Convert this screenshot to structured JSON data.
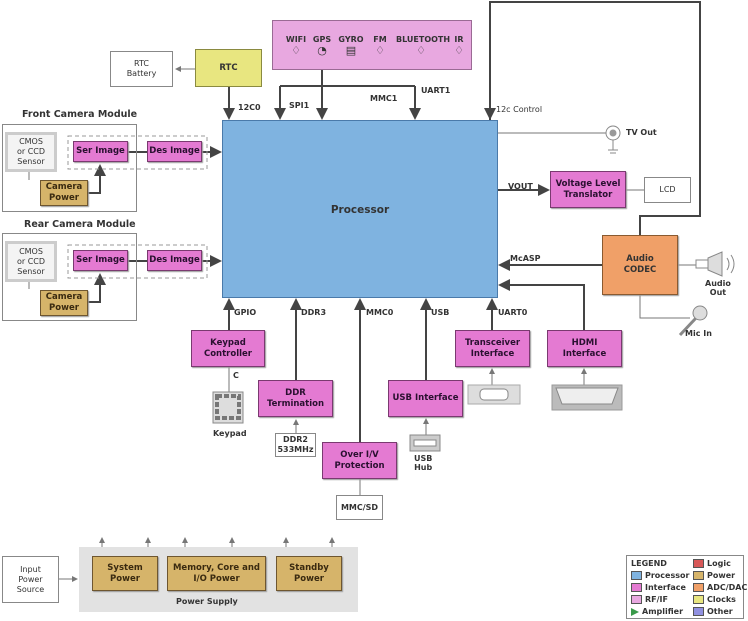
{
  "rf_block": {
    "items": [
      {
        "label": "WIFI",
        "icon": "antenna-icon"
      },
      {
        "label": "GPS",
        "icon": "gauge-icon"
      },
      {
        "label": "GYRO",
        "icon": "gyro-icon"
      },
      {
        "label": "FM",
        "icon": "antenna-icon"
      },
      {
        "label": "BLUETOOTH",
        "icon": "antenna-icon"
      },
      {
        "label": "IR",
        "icon": "antenna-icon"
      }
    ]
  },
  "rtc": {
    "label": "RTC",
    "battery": "RTC\nBattery",
    "bus": "12C0"
  },
  "processor": {
    "label": "Processor"
  },
  "buses": {
    "spi1": "SPI1",
    "mmc1": "MMC1",
    "uart1": "UART1",
    "i2c_control": "12c Control",
    "vout": "VOUT",
    "mcasp": "McASP",
    "gpio": "GPIO",
    "ddr3": "DDR3",
    "mmc0": "MMC0",
    "usb": "USB",
    "uart0": "UART0",
    "c": "C"
  },
  "front_camera": {
    "title": "Front Camera Module",
    "sensor": "CMOS\nor CCD\nSensor",
    "ser": "Ser Image",
    "des": "Des Image",
    "power": "Camera\nPower"
  },
  "rear_camera": {
    "title": "Rear Camera Module",
    "sensor": "CMOS\nor CCD\nSensor",
    "ser": "Ser Image",
    "des": "Des Image",
    "power": "Camera\nPower"
  },
  "blocks": {
    "tv_out": "TV Out",
    "vlt": "Voltage Level\nTranslator",
    "lcd": "LCD",
    "codec": "Audio\nCODEC",
    "audio_out": "Audio\nOut",
    "mic_in": "Mic In",
    "keypad_ctrl": "Keypad\nController",
    "keypad": "Keypad",
    "ddr_term": "DDR\nTermination",
    "ddr2": "DDR2\n533MHz",
    "over_iv": "Over I/V\nProtection",
    "mmc_sd": "MMC/SD",
    "usb_if": "USB Interface",
    "usb_hub": "USB\nHub",
    "transceiver": "Transceiver\nInterface",
    "hdmi": "HDMI\nInterface"
  },
  "power": {
    "input": "Input\nPower\nSource",
    "system": "System\nPower",
    "memory": "Memory, Core and\nI/O Power",
    "standby": "Standby\nPower",
    "supply": "Power Supply"
  },
  "legend": {
    "title": "LEGEND",
    "items": [
      {
        "label": "Processor",
        "color": "#7fb3e0"
      },
      {
        "label": "Interface",
        "color": "#e47ad2"
      },
      {
        "label": "RF/IF",
        "color": "#e8a8e0"
      },
      {
        "label": "Amplifier",
        "color": "#3a9a4a"
      },
      {
        "label": "Logic",
        "color": "#d85858"
      },
      {
        "label": "Power",
        "color": "#d6b46a"
      },
      {
        "label": "ADC/DAC",
        "color": "#f0a068"
      },
      {
        "label": "Clocks",
        "color": "#e8e680"
      },
      {
        "label": "Other",
        "color": "#9090e0"
      }
    ]
  }
}
